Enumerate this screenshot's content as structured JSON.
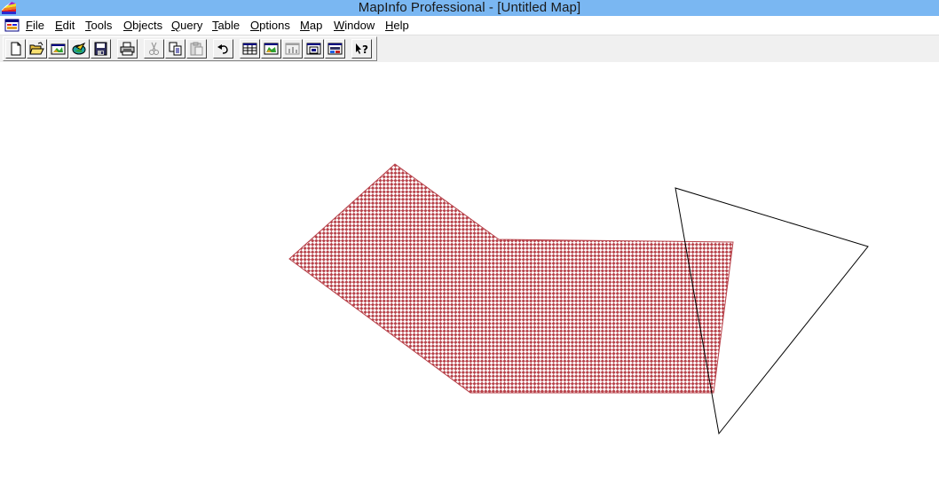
{
  "window": {
    "title": "MapInfo Professional - [Untitled Map]"
  },
  "menubar": {
    "items": [
      {
        "id": "file",
        "acc": "F",
        "rest": "ile"
      },
      {
        "id": "edit",
        "acc": "E",
        "rest": "dit"
      },
      {
        "id": "tools",
        "acc": "T",
        "rest": "ools"
      },
      {
        "id": "objects",
        "acc": "O",
        "rest": "bjects"
      },
      {
        "id": "query",
        "acc": "Q",
        "rest": "uery"
      },
      {
        "id": "table",
        "acc": "T",
        "rest": "able"
      },
      {
        "id": "options",
        "acc": "O",
        "rest": "ptions"
      },
      {
        "id": "map",
        "acc": "M",
        "rest": "ap"
      },
      {
        "id": "window",
        "acc": "W",
        "rest": "indow"
      },
      {
        "id": "help",
        "acc": "H",
        "rest": "elp"
      }
    ]
  },
  "toolbar": {
    "buttons": [
      {
        "icon": "new-document-icon",
        "enabled": true
      },
      {
        "icon": "open-folder-icon",
        "enabled": true
      },
      {
        "icon": "open-workspace-icon",
        "enabled": true
      },
      {
        "icon": "open-dbms-icon",
        "enabled": true
      },
      {
        "icon": "save-icon",
        "enabled": true
      },
      {
        "icon": "print-icon",
        "enabled": true
      },
      {
        "icon": "cut-icon",
        "enabled": false
      },
      {
        "icon": "copy-icon",
        "enabled": true
      },
      {
        "icon": "paste-icon",
        "enabled": false
      },
      {
        "icon": "undo-icon",
        "enabled": true
      },
      {
        "icon": "new-browser-icon",
        "enabled": true
      },
      {
        "icon": "new-mapper-icon",
        "enabled": true
      },
      {
        "icon": "new-grapher-icon",
        "enabled": false
      },
      {
        "icon": "new-layout-icon",
        "enabled": true
      },
      {
        "icon": "redistrict-icon",
        "enabled": true
      },
      {
        "icon": "help-pointer-icon",
        "enabled": true
      }
    ]
  },
  "map": {
    "objects": [
      {
        "type": "polygon",
        "fill": "checkered",
        "fill_color": "#b8434b"
      },
      {
        "type": "triangle",
        "fill": "none",
        "stroke_color": "#000000"
      }
    ]
  }
}
